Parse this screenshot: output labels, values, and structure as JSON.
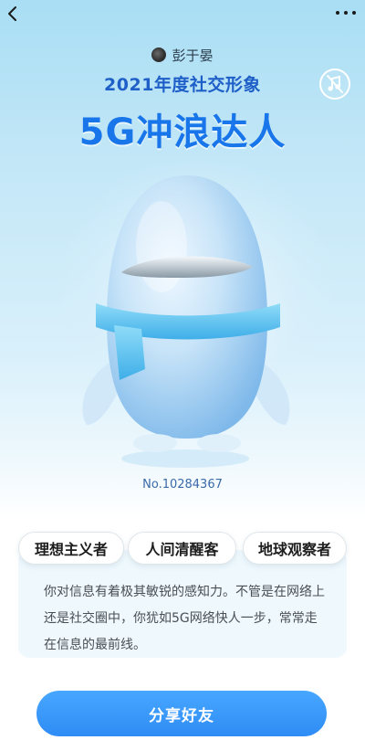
{
  "topbar": {
    "back_icon": "chevron-left-icon",
    "more_icon": "more-dots-icon"
  },
  "header": {
    "username": "彭于晏",
    "subtitle": "2021年度社交形象",
    "title": "5G冲浪达人",
    "mute_icon": "music-off-icon"
  },
  "mascot": {
    "body_color": "#b8def6",
    "scarf_color": "#58c0ee"
  },
  "card": {
    "number": "No.10284367",
    "tags": [
      "理想主义者",
      "人间清醒客",
      "地球观察者"
    ],
    "description": "你对信息有着极其敏锐的感知力。不管是在网络上还是社交圈中，你犹如5G网络快人一步，常常走在信息的最前线。"
  },
  "share": {
    "label": "分享好友"
  },
  "colors": {
    "accent": "#1976ea",
    "button": "#3a97fa",
    "subtitle": "#1f5fc8"
  }
}
